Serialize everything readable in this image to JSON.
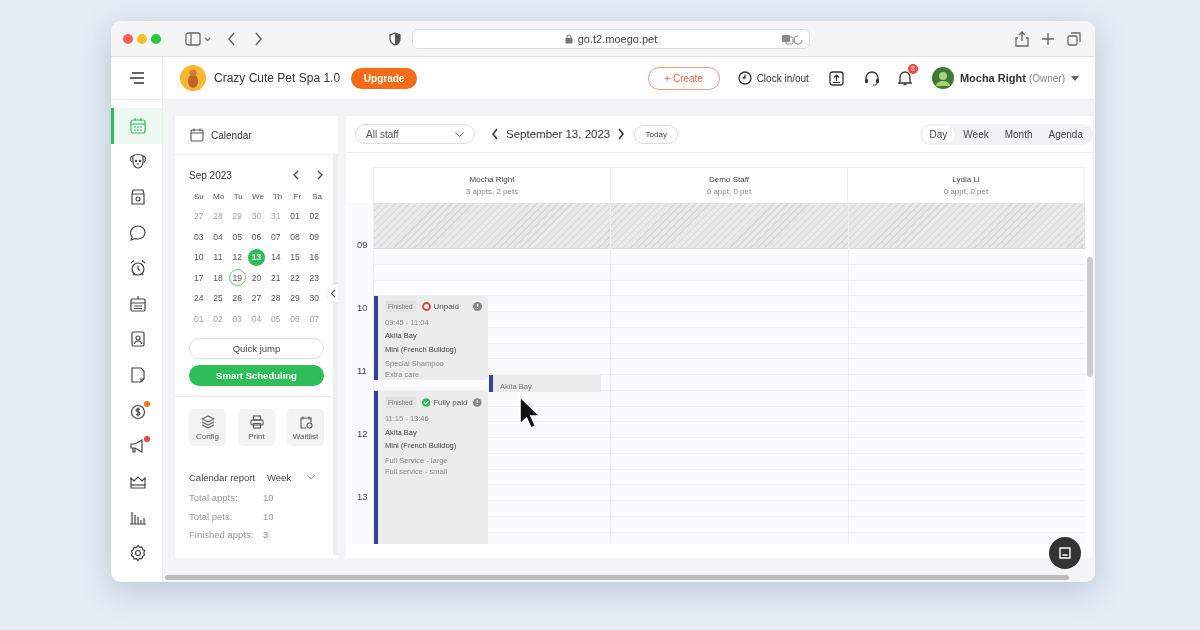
{
  "browser": {
    "url": "go.t2.moego.pet"
  },
  "header": {
    "business": "Crazy Cute Pet Spa 1.0",
    "upgrade": "Upgrade",
    "create": "+ Create",
    "clock": "Clock in/out",
    "notification_count": "8",
    "user": "Mocha Right",
    "role": "(Owner)"
  },
  "nav": [
    {
      "kind": "calendar",
      "selected": true
    },
    {
      "kind": "pet",
      "selected": false
    },
    {
      "kind": "store",
      "selected": false
    },
    {
      "kind": "chat",
      "selected": false
    },
    {
      "kind": "alarm",
      "selected": false
    },
    {
      "kind": "schedule",
      "selected": false
    },
    {
      "kind": "badge",
      "selected": false
    },
    {
      "kind": "document",
      "selected": false
    },
    {
      "kind": "payment",
      "selected": false,
      "color": "#f97316"
    },
    {
      "kind": "megaphone",
      "selected": false,
      "color": "#ef4444"
    },
    {
      "kind": "crown",
      "selected": false
    },
    {
      "kind": "chart",
      "selected": false
    },
    {
      "kind": "settings",
      "selected": false
    }
  ],
  "sidebar": {
    "title": "Calendar",
    "month": "Sep 2023",
    "weekdays": [
      "Su",
      "Mo",
      "Tu",
      "We",
      "Th",
      "Fr",
      "Sa"
    ],
    "weeks": [
      [
        {
          "d": "27",
          "muted": true
        },
        {
          "d": "28",
          "muted": true
        },
        {
          "d": "29",
          "muted": true
        },
        {
          "d": "30",
          "muted": true
        },
        {
          "d": "31",
          "muted": true
        },
        {
          "d": "01"
        },
        {
          "d": "02"
        }
      ],
      [
        {
          "d": "03"
        },
        {
          "d": "04"
        },
        {
          "d": "05"
        },
        {
          "d": "06"
        },
        {
          "d": "07"
        },
        {
          "d": "08"
        },
        {
          "d": "09"
        }
      ],
      [
        {
          "d": "10"
        },
        {
          "d": "11"
        },
        {
          "d": "12"
        },
        {
          "d": "13",
          "selected": true
        },
        {
          "d": "14"
        },
        {
          "d": "15"
        },
        {
          "d": "16"
        }
      ],
      [
        {
          "d": "17"
        },
        {
          "d": "18"
        },
        {
          "d": "19",
          "today": true
        },
        {
          "d": "20"
        },
        {
          "d": "21"
        },
        {
          "d": "22"
        },
        {
          "d": "23"
        }
      ],
      [
        {
          "d": "24"
        },
        {
          "d": "25"
        },
        {
          "d": "26"
        },
        {
          "d": "27"
        },
        {
          "d": "28"
        },
        {
          "d": "29"
        },
        {
          "d": "30"
        }
      ],
      [
        {
          "d": "01",
          "muted": true
        },
        {
          "d": "02",
          "muted": true
        },
        {
          "d": "03",
          "muted": true
        },
        {
          "d": "04",
          "muted": true
        },
        {
          "d": "05",
          "muted": true
        },
        {
          "d": "06",
          "muted": true
        },
        {
          "d": "07",
          "muted": true
        }
      ]
    ],
    "quick_jump": "Quick jump",
    "smart_scheduling": "Smart Scheduling",
    "tools": [
      {
        "kind": "config",
        "label": "Config"
      },
      {
        "kind": "print",
        "label": "Print"
      },
      {
        "kind": "waitlist",
        "label": "Waitlist"
      }
    ],
    "report": {
      "title": "Calendar report",
      "period": "Week",
      "stats": [
        {
          "label": "Total appts:",
          "value": "10"
        },
        {
          "label": "Total pets:",
          "value": "10"
        },
        {
          "label": "Finished appts:",
          "value": "3"
        }
      ]
    }
  },
  "toolbar": {
    "staff_filter": "All staff",
    "date": "September 13, 2023",
    "today": "Today",
    "views": [
      {
        "label": "Day",
        "selected": true
      },
      {
        "label": "Week",
        "selected": false
      },
      {
        "label": "Month",
        "selected": false
      },
      {
        "label": "Agenda",
        "selected": false
      }
    ]
  },
  "staff": [
    {
      "name": "Mocha Right",
      "summary": "3 appts, 2 pets"
    },
    {
      "name": "Demo Staff",
      "summary": "0 appt, 0 pet"
    },
    {
      "name": "Lydia Li",
      "summary": "0 appt, 0 pet"
    }
  ],
  "hours": [
    "09",
    "10",
    "11",
    "12",
    "13"
  ],
  "appointments": [
    {
      "status": "Finished",
      "payment": "Unpaid",
      "paid": false,
      "time": "09:45 - 11:04",
      "client": "Akita Bay",
      "pet": "Mini (French Bulldog)",
      "services": [
        "Special Shampoo",
        "Extra care"
      ]
    },
    {
      "status": "Finished",
      "payment": "Fully paid",
      "paid": true,
      "time": "11:15 - 13:46",
      "client": "Akita Bay",
      "pet": "Mini (French Bulldog)",
      "services": [
        "Full Service - large",
        "Full service - small"
      ]
    }
  ],
  "drag_preview": {
    "client": "Akita Bay"
  }
}
